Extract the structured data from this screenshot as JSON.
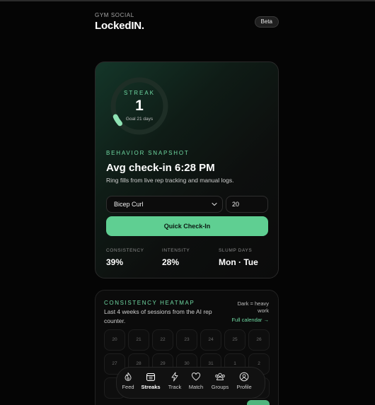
{
  "header": {
    "brand_sub": "GYM SOCIAL",
    "brand_title": "LockedIN.",
    "badge": "Beta"
  },
  "streak": {
    "label": "STREAK",
    "count": "1",
    "goal": "Goal 21 days",
    "progress": 0.05
  },
  "snapshot": {
    "label": "BEHAVIOR SNAPSHOT",
    "title": "Avg check-in 6:28 PM",
    "description": "Ring fills from live rep tracking and manual logs."
  },
  "checkin": {
    "exercise": "Bicep Curl",
    "reps": "20",
    "button": "Quick Check-In"
  },
  "stats": [
    {
      "label": "CONSISTENCY",
      "value": "39%"
    },
    {
      "label": "INTENSITY",
      "value": "28%"
    },
    {
      "label": "SLUMP DAYS",
      "value": "Mon · Tue"
    }
  ],
  "heatmap": {
    "label": "CONSISTENCY HEATMAP",
    "description": "Last 4 weeks of sessions from the AI rep counter.",
    "legend": "Dark = heavy work",
    "link": "Full calendar →",
    "row1": [
      "20",
      "21",
      "22",
      "23",
      "24",
      "25",
      "26"
    ],
    "row2": [
      "27",
      "28",
      "29",
      "30",
      "31",
      "1",
      "2"
    ]
  },
  "nav": [
    {
      "label": "Feed",
      "icon": "flame-icon"
    },
    {
      "label": "Streaks",
      "icon": "calendar-icon"
    },
    {
      "label": "Track",
      "icon": "bolt-icon"
    },
    {
      "label": "Match",
      "icon": "heart-icon"
    },
    {
      "label": "Groups",
      "icon": "users-icon"
    },
    {
      "label": "Profile",
      "icon": "profile-icon"
    }
  ],
  "colors": {
    "accent": "#5fcf92",
    "background": "#050505"
  }
}
